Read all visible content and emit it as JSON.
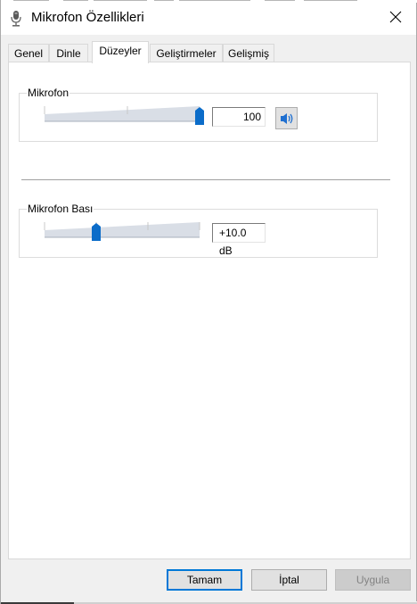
{
  "window": {
    "title": "Mikrofon Özellikleri"
  },
  "tabs": [
    {
      "label": "Genel",
      "active": false
    },
    {
      "label": "Dinle",
      "active": false
    },
    {
      "label": "Düzeyler",
      "active": true
    },
    {
      "label": "Geliştirmeler",
      "active": false
    },
    {
      "label": "Gelişmiş",
      "active": false
    }
  ],
  "levels": {
    "microphone": {
      "label": "Mikrofon",
      "value": "100",
      "level_fraction": 1.0
    },
    "boost": {
      "label": "Mikrofon Bası",
      "value": "+10.0 dB",
      "level_fraction": 0.33
    }
  },
  "buttons": {
    "ok": "Tamam",
    "cancel": "İptal",
    "apply": "Uygula"
  },
  "colors": {
    "accent": "#0078d7",
    "panel": "#ffffff",
    "dialog": "#f0f0f0"
  },
  "icons": {
    "title": "microphone-icon",
    "close": "close-icon",
    "mute": "speaker-icon"
  }
}
